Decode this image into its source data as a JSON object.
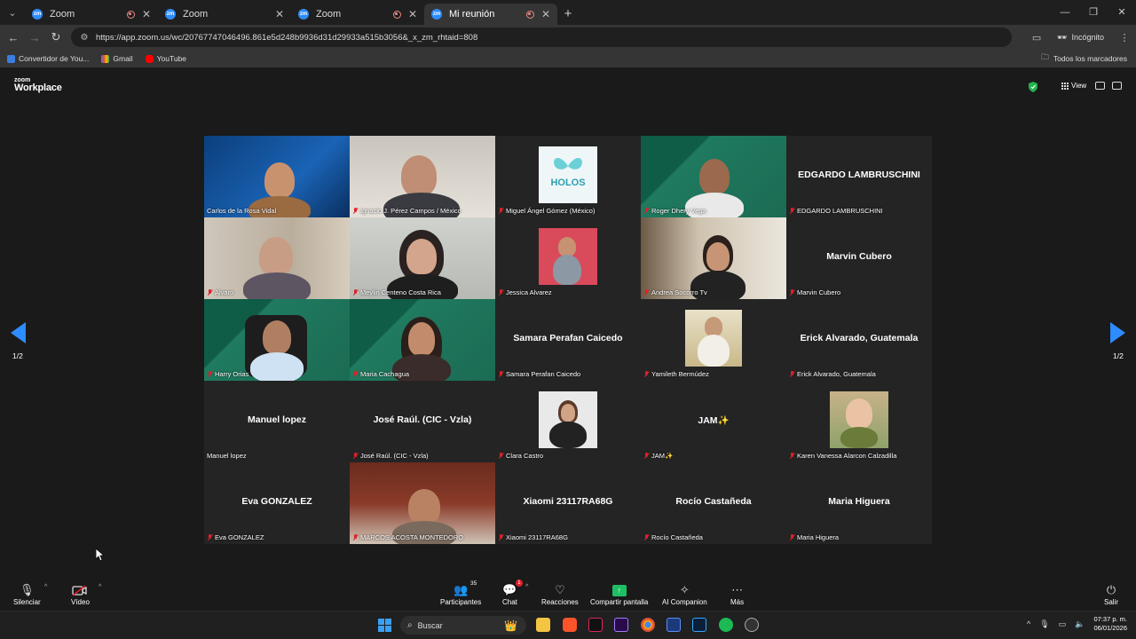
{
  "browser": {
    "tabs": [
      {
        "title": "Zoom",
        "recording": true,
        "active": false
      },
      {
        "title": "Zoom",
        "recording": false,
        "active": false
      },
      {
        "title": "Zoom",
        "recording": true,
        "active": false
      },
      {
        "title": "Mi reunión",
        "recording": true,
        "active": true
      }
    ],
    "url": "https://app.zoom.us/wc/20767747046496.861e5d248b9936d31d29933a515b3056&_x_zm_rhtaid=808",
    "profile": "Incógnito",
    "bookmarks": [
      "Convertidor de You...",
      "Gmail",
      "YouTube"
    ],
    "all_bookmarks": "Todos los marcadores"
  },
  "zoom": {
    "logo_top": "zoom",
    "logo_bottom": "Workplace",
    "view_label": "View",
    "page_indicator": "1/2",
    "colors": {
      "accent": "#2d8cff",
      "muted": "#e0202a",
      "share": "#1fbf63"
    }
  },
  "participants": [
    {
      "name": "Carlos de la Rosa Vidal",
      "video": true,
      "muted": false,
      "active_speaker": true
    },
    {
      "name": "Ignacio J. Pérez Campos / México",
      "video": true,
      "muted": true
    },
    {
      "name": "Miguel Ángel Gómez (México)",
      "video": false,
      "avatar": true,
      "muted": true
    },
    {
      "name": "Roger Dhery Vega",
      "video": true,
      "muted": true
    },
    {
      "name": "EDGARDO LAMBRUSCHINI",
      "video": false,
      "muted": true
    },
    {
      "name": "Alvaro",
      "video": true,
      "muted": true
    },
    {
      "name": "Meylin Centeno Costa Rica",
      "video": true,
      "muted": true
    },
    {
      "name": "Jessica Alvarez",
      "video": false,
      "avatar": true,
      "muted": true
    },
    {
      "name": "Andrea Socorro Tv",
      "video": true,
      "muted": true
    },
    {
      "name": "Marvin Cubero",
      "video": false,
      "muted": true
    },
    {
      "name": "Harry Orias",
      "video": true,
      "muted": true
    },
    {
      "name": "Maria Cachagua",
      "video": true,
      "muted": true
    },
    {
      "name": "Samara Perafan Caicedo",
      "video": false,
      "muted": true
    },
    {
      "name": "Yamileth Bermúdez",
      "video": false,
      "avatar": true,
      "muted": true
    },
    {
      "name": "Erick Alvarado, Guatemala",
      "video": false,
      "muted": true
    },
    {
      "name": "Manuel lopez",
      "video": false,
      "muted": false
    },
    {
      "name": "José Raúl. (CIC - Vzla)",
      "video": false,
      "muted": true
    },
    {
      "name": "Clara Castro",
      "video": false,
      "avatar": true,
      "muted": true
    },
    {
      "name": "JAM✨",
      "video": false,
      "muted": true
    },
    {
      "name": "Karen Vanessa Alarcon Calzadilla",
      "video": false,
      "avatar": true,
      "muted": true
    },
    {
      "name": "Eva GONZALEZ",
      "video": false,
      "muted": true
    },
    {
      "name": "MARCOS ACOSTA MONTEDORO",
      "video": true,
      "muted": true
    },
    {
      "name": "Xiaomi 23117RA68G",
      "video": false,
      "muted": true
    },
    {
      "name": "Rocío Castañeda",
      "video": false,
      "muted": true
    },
    {
      "name": "Maria Higuera",
      "video": false,
      "muted": true
    }
  ],
  "toolbar": {
    "mute": "Silenciar",
    "video": "Vídeo",
    "participants": "Participantes",
    "participants_count": "35",
    "chat": "Chat",
    "chat_badge": "1",
    "reactions": "Reacciones",
    "share": "Compartir pantalla",
    "companion": "AI Companion",
    "more": "Más",
    "leave": "Salir"
  },
  "taskbar": {
    "search_placeholder": "Buscar",
    "time": "07:37 p. m.",
    "date": "06/01/2026"
  }
}
